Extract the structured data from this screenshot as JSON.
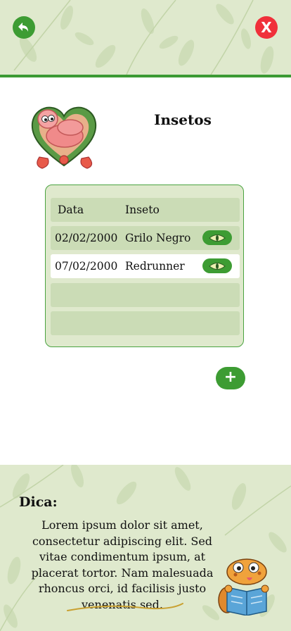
{
  "header": {
    "back_icon": "arrow-back-icon",
    "close_label": "X"
  },
  "page": {
    "title": "Insetos"
  },
  "table": {
    "columns": [
      "Data",
      "Inseto"
    ],
    "rows": [
      {
        "date": "02/02/2000",
        "insect": "Grilo Negro",
        "action_icon": "eye-icon"
      },
      {
        "date": "07/02/2000",
        "insect": "Redrunner",
        "action_icon": "eye-icon"
      }
    ]
  },
  "add_button": {
    "label": "+"
  },
  "tip": {
    "label": "Dica:",
    "text": "Lorem ipsum dolor sit amet, consectetur adipiscing elit. Sed vitae condimentum ipsum, at placerat tortor. Nam malesuada rhoncus orci, id facilisis justo venenatis sed."
  },
  "colors": {
    "primary_green": "#3d9c33",
    "close_red": "#f0303a",
    "leaf_bg": "#dfe9cd",
    "row_green": "#cbdcb6"
  }
}
